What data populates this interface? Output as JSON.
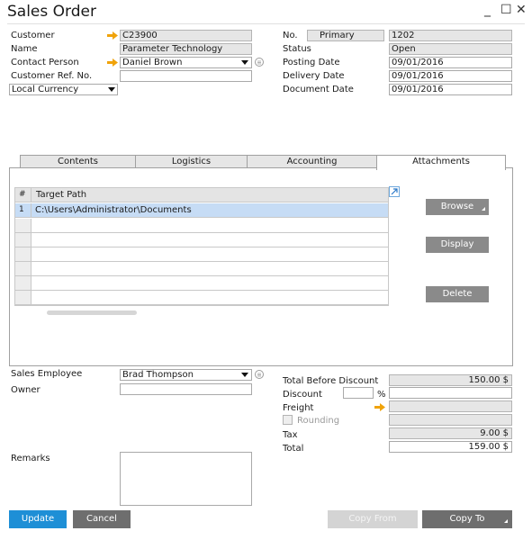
{
  "window": {
    "title": "Sales Order",
    "minimize": "_",
    "maximize": "☐",
    "close": "✕"
  },
  "header_left": {
    "customer_label": "Customer",
    "customer_value": "C23900",
    "name_label": "Name",
    "name_value": "Parameter Technology",
    "contact_label": "Contact Person",
    "contact_value": "Daniel Brown",
    "ref_label": "Customer Ref. No.",
    "ref_value": "",
    "currency_value": "Local Currency"
  },
  "header_right": {
    "no_label": "No.",
    "series_value": "Primary",
    "no_value": "1202",
    "status_label": "Status",
    "status_value": "Open",
    "posting_label": "Posting Date",
    "posting_value": "09/01/2016",
    "delivery_label": "Delivery Date",
    "delivery_value": "09/01/2016",
    "document_label": "Document Date",
    "document_value": "09/01/2016"
  },
  "tabs": [
    {
      "label": "Contents"
    },
    {
      "label": "Logistics"
    },
    {
      "label": "Accounting"
    },
    {
      "label": "Attachments"
    }
  ],
  "attachments": {
    "col_num": "#",
    "col_path": "Target Path",
    "rows": [
      {
        "num": "1",
        "path": "C:\\Users\\Administrator\\Documents"
      }
    ],
    "browse_label": "Browse",
    "display_label": "Display",
    "delete_label": "Delete"
  },
  "footer_left": {
    "sales_employee_label": "Sales Employee",
    "sales_employee_value": "Brad Thompson",
    "owner_label": "Owner",
    "owner_value": "",
    "remarks_label": "Remarks",
    "remarks_value": ""
  },
  "totals": {
    "before_discount_label": "Total Before Discount",
    "before_discount_value": "150.00 $",
    "discount_label": "Discount",
    "discount_pct": "",
    "pct_sign": "%",
    "discount_value": "",
    "freight_label": "Freight",
    "freight_value": "",
    "rounding_label": "Rounding",
    "rounding_value": "",
    "tax_label": "Tax",
    "tax_value": "9.00 $",
    "total_label": "Total",
    "total_value": "159.00 $"
  },
  "buttons": {
    "update": "Update",
    "cancel": "Cancel",
    "copy_from": "Copy From",
    "copy_to": "Copy To"
  },
  "colors": {
    "link_arrow": "#f0a30a",
    "selected_row": "#c6dcf5",
    "update_button": "#1e8fd6",
    "gray_button": "#6e6e6e",
    "disabled_button": "#d4d4d4"
  }
}
